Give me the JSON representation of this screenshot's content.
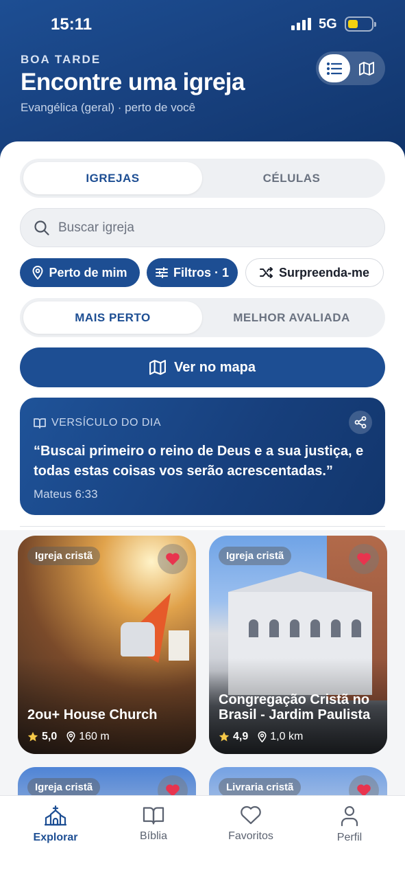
{
  "status_bar": {
    "time": "15:11",
    "network": "5G"
  },
  "header": {
    "greeting": "BOA TARDE",
    "title": "Encontre uma igreja",
    "subtitle": "Evangélica (geral) · perto de você",
    "view_toggle": {
      "list_icon": "list-icon",
      "map_icon": "map-icon",
      "active": "list"
    }
  },
  "tabs": {
    "items": [
      "IGREJAS",
      "CÉLULAS"
    ],
    "active": "IGREJAS"
  },
  "search": {
    "placeholder": "Buscar igreja",
    "value": ""
  },
  "chips": {
    "near": "Perto de mim",
    "filters": "Filtros · 1",
    "surprise": "Surpreenda-me"
  },
  "sort": {
    "items": [
      "MAIS PERTO",
      "MELHOR AVALIADA"
    ],
    "active": "MAIS PERTO"
  },
  "map_button": "Ver no mapa",
  "verse": {
    "label": "VERSÍCULO DO DIA",
    "text": "“Buscai primeiro o reino de Deus e a sua justiça, e todas estas coisas vos serão acrescentadas.”",
    "reference": "Mateus 6:33"
  },
  "cards": [
    {
      "tag": "Igreja cristã",
      "name": "2ou+ House Church",
      "rating": "5,0",
      "distance": "160 m",
      "favorite": true
    },
    {
      "tag": "Igreja cristã",
      "name": "Congregação Cristã no Brasil - Jardim Paulista",
      "rating": "4,9",
      "distance": "1,0 km",
      "favorite": true
    },
    {
      "tag": "Igreja cristã",
      "favorite": true
    },
    {
      "tag": "Livraria cristã",
      "favorite": true
    }
  ],
  "bottom_nav": {
    "items": [
      "Explorar",
      "Bíblia",
      "Favoritos",
      "Perfil"
    ],
    "active": "Explorar"
  },
  "colors": {
    "primary": "#1d4e93",
    "favorite": "#e8344e",
    "battery": "#f5d20f"
  }
}
